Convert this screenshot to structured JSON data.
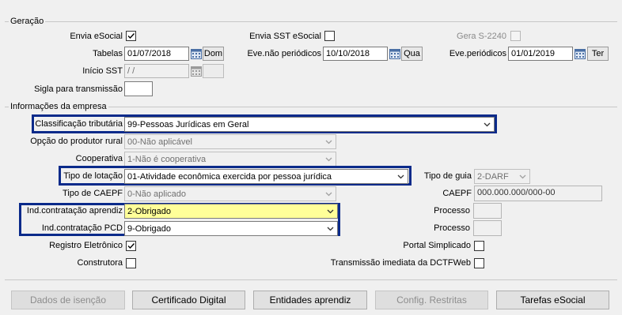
{
  "geracao": {
    "title": "Geração",
    "envia_esocial": {
      "label": "Envia eSocial",
      "checked": true
    },
    "envia_sst": {
      "label": "Envia SST eSocial",
      "checked": false
    },
    "gera_s2240": {
      "label": "Gera S-2240",
      "checked": false
    },
    "tabelas": {
      "label": "Tabelas",
      "value": "01/07/2018",
      "day": "Dom"
    },
    "eve_nao_periodicos": {
      "label": "Eve.não periódicos",
      "value": "10/10/2018",
      "day": "Qua"
    },
    "eve_periodicos": {
      "label": "Eve.periódicos",
      "value": "01/01/2019",
      "day": "Ter"
    },
    "inicio_sst": {
      "label": "Início SST",
      "value": " /  /"
    },
    "sigla": {
      "label": "Sigla para transmissão",
      "value": ""
    }
  },
  "empresa": {
    "title": "Informações da empresa",
    "classificacao": {
      "label": "Classificação tributária",
      "value": "99-Pessoas Jurídicas em Geral"
    },
    "produtor_rural": {
      "label": "Opção do produtor rural",
      "value": "00-Não aplicável"
    },
    "cooperativa": {
      "label": "Cooperativa",
      "value": "1-Não é cooperativa"
    },
    "tipo_lotacao": {
      "label": "Tipo de lotação",
      "value": "01-Atividade econômica exercida por pessoa jurídica"
    },
    "tipo_guia": {
      "label": "Tipo de guia",
      "value": "2-DARF"
    },
    "tipo_caepf": {
      "label": "Tipo de CAEPF",
      "value": "0-Não aplicado"
    },
    "caepf": {
      "label": "CAEPF",
      "value": "000.000.000/000-00"
    },
    "aprendiz": {
      "label": "Ind.contratação aprendiz",
      "value": "2-Obrigado",
      "processo_label": "Processo"
    },
    "pcd": {
      "label": "Ind.contratação PCD",
      "value": "9-Obrigado",
      "processo_label": "Processo"
    },
    "registro_eletronico": {
      "label": "Registro Eletrônico",
      "checked": true
    },
    "construtora": {
      "label": "Construtora",
      "checked": false
    },
    "portal_simplificado": {
      "label": "Portal Simplicado",
      "checked": false
    },
    "transmissao_dctf": {
      "label": "Transmissão imediata da DCTFWeb",
      "checked": false
    }
  },
  "buttons": {
    "dados_isencao": "Dados de isenção",
    "certificado": "Certificado Digital",
    "entidades": "Entidades aprendiz",
    "config_restritas": "Config. Restritas",
    "tarefas": "Tarefas eSocial"
  },
  "colors": {
    "highlight_border": "#0a2a8a",
    "highlight_fill": "#ffff99"
  }
}
